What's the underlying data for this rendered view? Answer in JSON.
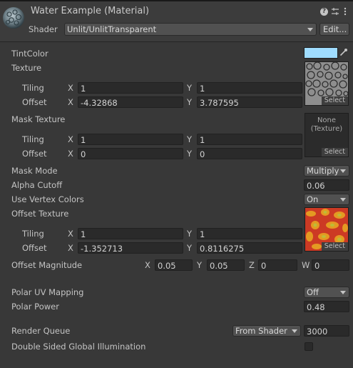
{
  "header": {
    "title": "Water Example (Material)",
    "shader_label": "Shader",
    "shader_value": "Unlit/UnlitTransparent",
    "edit_button": "Edit...",
    "help_icon": "help-icon",
    "settings_icon": "sliders-icon",
    "menu_icon": "kebab-menu-icon"
  },
  "tint": {
    "label": "TintColor",
    "color": "#9fdcff"
  },
  "texture": {
    "label": "Texture",
    "tiling_label": "Tiling",
    "offset_label": "Offset",
    "tiling_x": "1",
    "tiling_y": "1",
    "offset_x": "-4.32868",
    "offset_y": "3.787595",
    "select": "Select"
  },
  "mask_texture": {
    "label": "Mask Texture",
    "tiling_label": "Tiling",
    "offset_label": "Offset",
    "tiling_x": "1",
    "tiling_y": "1",
    "offset_x": "0",
    "offset_y": "0",
    "none_line1": "None",
    "none_line2": "(Texture)",
    "select": "Select"
  },
  "mask_mode": {
    "label": "Mask Mode",
    "value": "Multiply"
  },
  "alpha_cutoff": {
    "label": "Alpha Cutoff",
    "value": "0.06"
  },
  "vertex_colors": {
    "label": "Use Vertex Colors",
    "value": "On"
  },
  "offset_texture": {
    "label": "Offset Texture",
    "tiling_label": "Tiling",
    "offset_label": "Offset",
    "tiling_x": "1",
    "tiling_y": "1",
    "offset_x": "-1.352713",
    "offset_y": "0.8116275",
    "select": "Select"
  },
  "offset_magnitude": {
    "label": "Offset Magnitude",
    "x": "0.05",
    "y": "0.05",
    "z": "0",
    "w": "0"
  },
  "axes": {
    "x": "X",
    "y": "Y",
    "z": "Z",
    "w": "W"
  },
  "polar_uv": {
    "label": "Polar UV Mapping",
    "value": "Off"
  },
  "polar_power": {
    "label": "Polar Power",
    "value": "0.48"
  },
  "render_queue": {
    "label": "Render Queue",
    "mode": "From Shader",
    "value": "3000"
  },
  "double_sided_gi": {
    "label": "Double Sided Global Illumination",
    "checked": false
  }
}
